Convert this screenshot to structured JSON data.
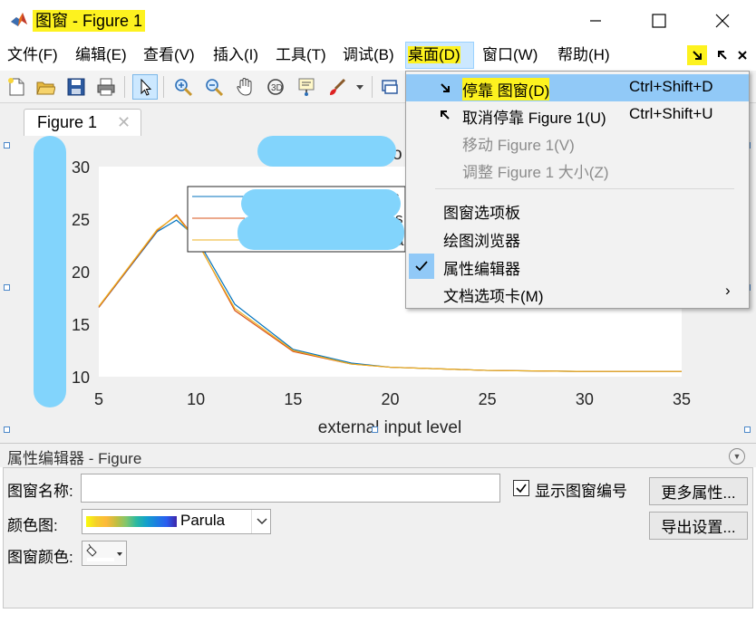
{
  "window": {
    "title": "图窗 - Figure 1",
    "minimize_glyph": "—",
    "maximize_glyph": "☐",
    "close_glyph": "✕"
  },
  "menubar": {
    "items": [
      {
        "label": "文件(F)"
      },
      {
        "label": "编辑(E)"
      },
      {
        "label": "查看(V)"
      },
      {
        "label": "插入(I)"
      },
      {
        "label": "工具(T)"
      },
      {
        "label": "调试(B)"
      },
      {
        "label": "桌面(D)"
      },
      {
        "label": "窗口(W)"
      },
      {
        "label": "帮助(H)"
      }
    ],
    "active_index": 6
  },
  "toolbar": {
    "icons": [
      "new-file-icon",
      "open-folder-icon",
      "save-icon",
      "print-icon",
      "pointer-icon",
      "zoom-in-icon",
      "zoom-out-icon",
      "pan-hand-icon",
      "rotate-3d-icon",
      "data-cursor-icon",
      "brush-icon",
      "dropdown-arrow-icon",
      "link-plot-icon"
    ]
  },
  "figure_tab": {
    "label": "Figure 1",
    "close_glyph": "✕"
  },
  "dropdown": {
    "items": [
      {
        "label": "停靠 图窗(D)",
        "shortcut": "Ctrl+Shift+D",
        "enabled": true
      },
      {
        "label": "取消停靠 Figure 1(U)",
        "shortcut": "Ctrl+Shift+U",
        "enabled": true
      },
      {
        "label": "移动 Figure 1(V)",
        "shortcut": "",
        "enabled": false
      },
      {
        "label": "调整 Figure 1 大小(Z)",
        "shortcut": "",
        "enabled": false
      },
      {
        "label": "图窗选项板",
        "shortcut": "",
        "enabled": true
      },
      {
        "label": "绘图浏览器",
        "shortcut": "",
        "enabled": true
      },
      {
        "label": "属性编辑器",
        "shortcut": "",
        "enabled": true,
        "checked": true
      },
      {
        "label": "文档选项卡(M)",
        "shortcut": "",
        "enabled": true,
        "submenu": true
      }
    ],
    "submenu_glyph": "›",
    "check_glyph": "✓"
  },
  "plot": {
    "title_fragment": "o",
    "xlabel": "external input level",
    "legend_fragment_1": "s",
    "legend_fragment_2": "s",
    "legend_fragment_3": "a"
  },
  "chart_data": {
    "type": "line",
    "xlabel": "external input level",
    "ylabel": "",
    "xlim": [
      5,
      35
    ],
    "ylim": [
      10,
      30
    ],
    "xticks": [
      5,
      10,
      15,
      20,
      25,
      30,
      35
    ],
    "yticks": [
      10,
      15,
      20,
      25,
      30
    ],
    "legend_position": "top-center",
    "series": [
      {
        "color": "#0072bd",
        "x": [
          5,
          8,
          9,
          10,
          12,
          15,
          18,
          20,
          25,
          30,
          35
        ],
        "y": [
          16.6,
          23.8,
          24.9,
          23.3,
          16.9,
          12.6,
          11.3,
          10.9,
          10.6,
          10.5,
          10.5
        ]
      },
      {
        "color": "#d95319",
        "x": [
          5,
          8,
          9,
          10,
          12,
          15,
          18,
          20,
          25,
          30,
          35
        ],
        "y": [
          16.6,
          23.9,
          25.4,
          23.1,
          16.3,
          12.4,
          11.2,
          10.9,
          10.6,
          10.5,
          10.5
        ]
      },
      {
        "color": "#edb120",
        "x": [
          5,
          8,
          9,
          10,
          12,
          15,
          18,
          20,
          25,
          30,
          35
        ],
        "y": [
          16.7,
          24.0,
          25.3,
          23.0,
          16.5,
          12.5,
          11.2,
          10.9,
          10.6,
          10.5,
          10.5
        ]
      }
    ]
  },
  "property_editor": {
    "title": "属性编辑器 - Figure",
    "name_label": "图窗名称:",
    "name_value": "",
    "show_number_label": "显示图窗编号",
    "show_number_checked": true,
    "more_props_button": "更多属性...",
    "colormap_label": "颜色图:",
    "colormap_value": "Parula",
    "export_button": "导出设置...",
    "fig_color_label": "图窗颜色:"
  }
}
